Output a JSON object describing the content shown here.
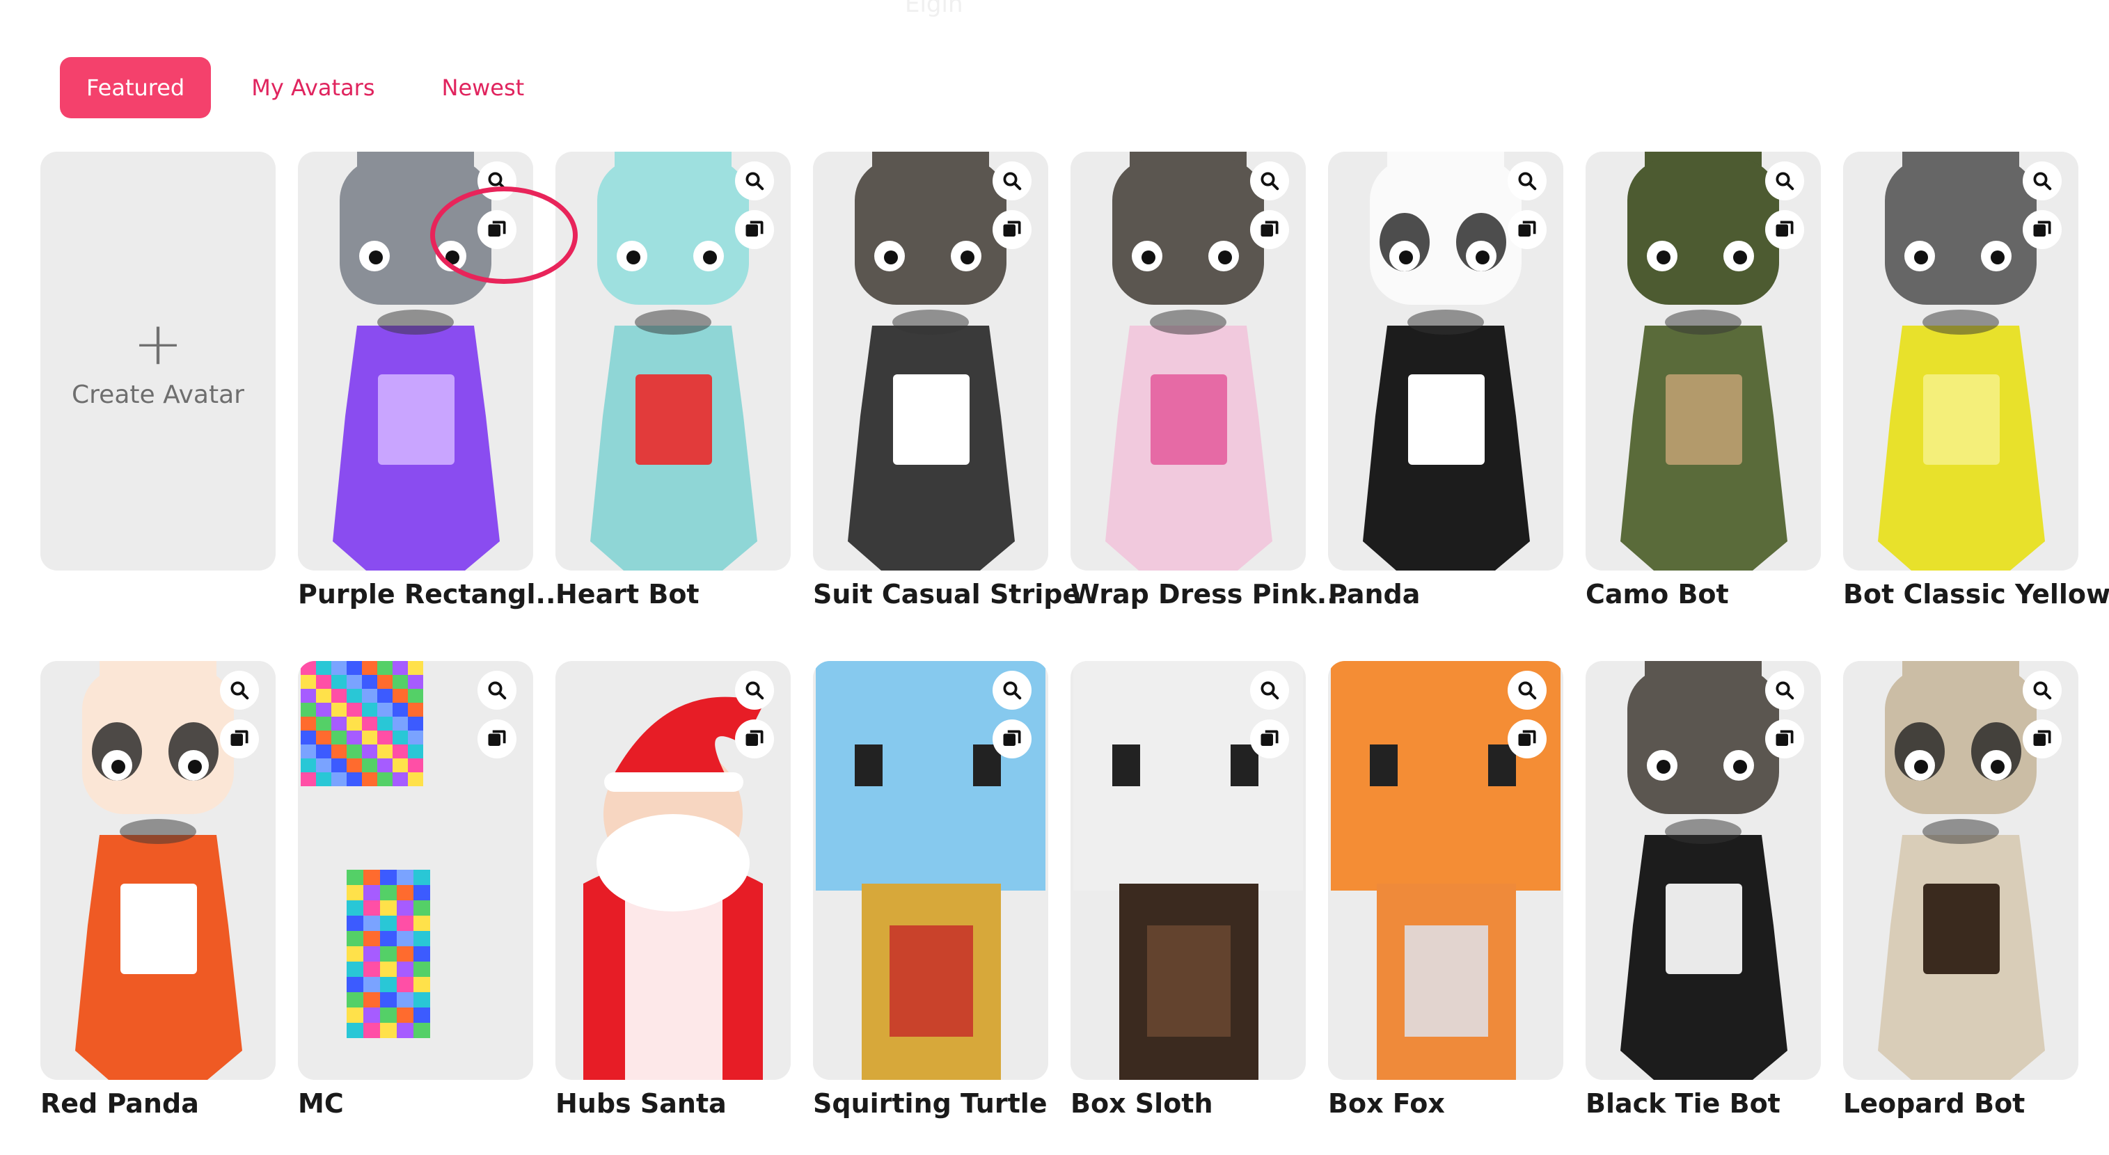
{
  "header": {
    "faint_text": "Elgin"
  },
  "tabs": [
    {
      "label": "Featured",
      "active": true
    },
    {
      "label": "My Avatars",
      "active": false
    },
    {
      "label": "Newest",
      "active": false
    }
  ],
  "create_card": {
    "label": "Create Avatar",
    "plus": "+"
  },
  "avatars": [
    {
      "name": "Purple Rectangl...",
      "style": "robot",
      "body": "#8a4cf0",
      "head": "#8a8f97",
      "accent": "#c9a5ff"
    },
    {
      "name": "Heart Bot",
      "style": "robot-heart",
      "body": "#8fd6d6",
      "head": "#9ee0df",
      "accent": "#e23b3b"
    },
    {
      "name": "Suit Casual Stripe",
      "style": "suit",
      "body": "#3a3a3a",
      "head": "#5b5650",
      "accent": "#ffffff"
    },
    {
      "name": "Wrap Dress Pink...",
      "style": "dress",
      "body": "#f1c9dd",
      "head": "#5b5650",
      "accent": "#e66aa5"
    },
    {
      "name": "Panda",
      "style": "panda",
      "body": "#1c1c1c",
      "head": "#fafafa",
      "accent": "#ffffff"
    },
    {
      "name": "Camo Bot",
      "style": "camo",
      "body": "#5a6b3a",
      "head": "#4d5b31",
      "accent": "#b39a6b"
    },
    {
      "name": "Bot Classic Yellow",
      "style": "robot",
      "body": "#e8e12b",
      "head": "#666666",
      "accent": "#f4ef7a"
    },
    {
      "name": "Red Panda",
      "style": "redpanda",
      "body": "#ef5a24",
      "head": "#fbe6d6",
      "accent": "#ffffff"
    },
    {
      "name": "MC",
      "style": "pixel",
      "body": "#7aa3ff",
      "head": "#54d067",
      "accent": "#ff46a5"
    },
    {
      "name": "Hubs Santa",
      "style": "santa",
      "body": "#e71d26",
      "head": "#f7d6c1",
      "accent": "#ffffff"
    },
    {
      "name": "Squirting Turtle",
      "style": "turtle",
      "body": "#d7a83a",
      "head": "#86c9ee",
      "accent": "#c62828"
    },
    {
      "name": "Box Sloth",
      "style": "sloth",
      "body": "#3b2a1f",
      "head": "#efefef",
      "accent": "#6e4a32"
    },
    {
      "name": "Box Fox",
      "style": "fox",
      "body": "#ef8a3a",
      "head": "#f48d35",
      "accent": "#dfe6f5"
    },
    {
      "name": "Black Tie Bot",
      "style": "tux",
      "body": "#1c1c1c",
      "head": "#5b5650",
      "accent": "#eaeaea"
    },
    {
      "name": "Leopard Bot",
      "style": "leopard",
      "body": "#d9cdb8",
      "head": "#cbbda5",
      "accent": "#3a2a1e"
    }
  ],
  "icons": {
    "search": "search-icon",
    "copy": "copy-icon"
  },
  "highlight": {
    "color": "#e8245a",
    "target": "Purple Rectangl..."
  }
}
